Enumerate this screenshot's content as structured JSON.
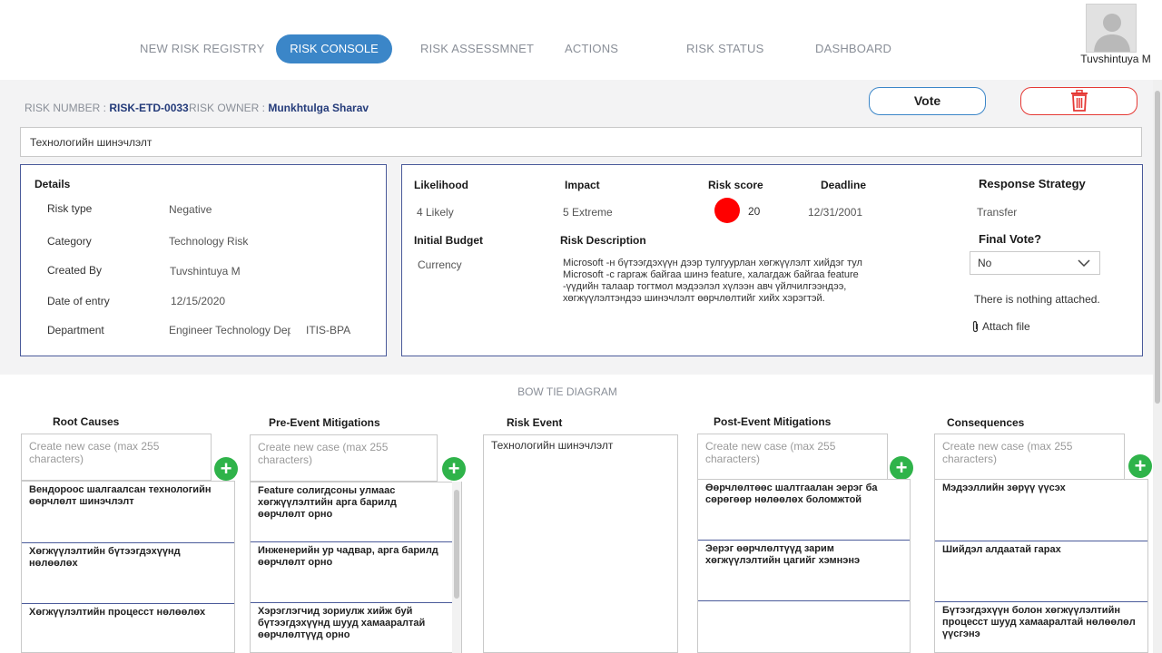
{
  "nav": {
    "items": [
      "NEW RISK REGISTRY",
      "RISK CONSOLE",
      "RISK ASSESSMNET",
      "ACTIONS",
      "RISK STATUS",
      "DASHBOARD"
    ],
    "active": "RISK CONSOLE"
  },
  "user": {
    "name": "Tuvshintuya M"
  },
  "header": {
    "risk_number_label": "RISK NUMBER :",
    "risk_number": "RISK-ETD-0033",
    "risk_owner_label": "RISK OWNER :",
    "risk_owner": "Munkhtulga Sharav",
    "vote_label": "Vote",
    "delete_icon": "trash-icon",
    "title_value": "Технологийн шинэчлэлт"
  },
  "details": {
    "heading": "Details",
    "rows": [
      {
        "label": "Risk type",
        "value": "Negative"
      },
      {
        "label": "Category",
        "value": "Technology Risk"
      },
      {
        "label": "Created By",
        "value": "Tuvshintuya M"
      },
      {
        "label": "Date of entry",
        "value": "12/15/2020"
      },
      {
        "label": "Department",
        "value": "Engineer Technology Depa",
        "extra": "ITIS-BPA"
      }
    ]
  },
  "assessment": {
    "likelihood_label": "Likelihood",
    "likelihood": "4 Likely",
    "impact_label": "Impact",
    "impact": "5 Extreme",
    "score_label": "Risk score",
    "score": "20",
    "score_color": "#ff0000",
    "deadline_label": "Deadline",
    "deadline": "12/31/2001",
    "budget_label": "Initial Budget",
    "budget": "Currency",
    "desc_label": "Risk Description",
    "description": "Microsoft -н бүтээгдэхүүн дээр тулгуурлан хөгжүүлэлт хийдэг тул Microsoft -с гаргаж байгаа шинэ feature, халагдаж байгаа feature -үүдийн талаар тогтмол мэдээлэл хүлээн авч үйлчилгээндээ, хөгжүүлэлтэндээ шинэчлэлт өөрчлөлтийг хийх хэрэгтэй.",
    "strategy_label": "Response Strategy",
    "strategy": "Transfer",
    "final_vote_label": "Final Vote?",
    "final_vote": "No",
    "attachments": "There is nothing attached.",
    "attach_label": "Attach file"
  },
  "bowtie": {
    "title": "BOW TIE DIAGRAM",
    "placeholder": "Create new case (max 255 characters)",
    "root_causes": {
      "heading": "Root Causes",
      "items": [
        "Вендороос шалгаалсан технологийн өөрчлөлт шинэчлэлт",
        "Хөгжүүлэлтийн бүтээгдэхүүнд нөлөөлөх",
        "Хөгжүүлэлтийн процесст нөлөөлөх"
      ]
    },
    "pre_mitigations": {
      "heading": "Pre-Event Mitigations",
      "items": [
        "Feature солигдсоны улмаас хөгжүүлэлтийн арга барилд өөрчлөлт орно",
        "Инженерийн ур чадвар, арга барилд өөрчлөлт орно",
        "Хэрэглэгчид зориулж хийж буй бүтээгдэхүүнд шууд хамааралтай өөрчлөлтүүд орно"
      ]
    },
    "risk_event": {
      "heading": "Risk Event",
      "value": "Технологийн шинэчлэлт"
    },
    "post_mitigations": {
      "heading": "Post-Event Mitigations",
      "items": [
        "Өөрчлөлтөөс шалтгаалан эерэг ба сөрөгөөр нөлөөлөх боломжтой",
        "Эерэг өөрчлөлтүүд зарим хөгжүүлэлтийн цагийг хэмнэнэ",
        ""
      ]
    },
    "consequences": {
      "heading": "Consequences",
      "items": [
        "Мэдээллийн зөрүү үүсэх",
        "Шийдэл алдаатай гарах",
        "Бүтээгдэхүүн болон хөгжүүлэлтийн процесст шууд хамааралтай нөлөөлөл үүсгэнэ"
      ]
    }
  }
}
